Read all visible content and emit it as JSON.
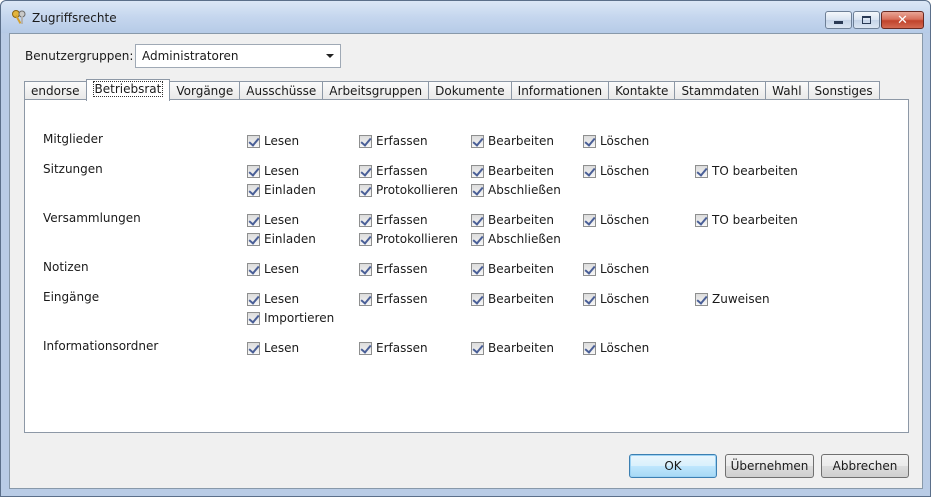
{
  "window": {
    "title": "Zugriffsrechte"
  },
  "groups": {
    "label": "Benutzergruppen:",
    "selected": "Administratoren"
  },
  "tabs": [
    "endorse",
    "Betriebsrat",
    "Vorgänge",
    "Ausschüsse",
    "Arbeitsgruppen",
    "Dokumente",
    "Informationen",
    "Kontakte",
    "Stammdaten",
    "Wahl",
    "Sonstiges"
  ],
  "active_tab": "Betriebsrat",
  "permissions": [
    {
      "label": "Mitglieder",
      "rows": [
        [
          "Lesen",
          "Erfassen",
          "Bearbeiten",
          "Löschen"
        ]
      ]
    },
    {
      "label": "Sitzungen",
      "rows": [
        [
          "Lesen",
          "Erfassen",
          "Bearbeiten",
          "Löschen",
          "TO bearbeiten"
        ],
        [
          "Einladen",
          "Protokollieren",
          "Abschließen"
        ]
      ]
    },
    {
      "label": "Versammlungen",
      "rows": [
        [
          "Lesen",
          "Erfassen",
          "Bearbeiten",
          "Löschen",
          "TO bearbeiten"
        ],
        [
          "Einladen",
          "Protokollieren",
          "Abschließen"
        ]
      ]
    },
    {
      "label": "Notizen",
      "rows": [
        [
          "Lesen",
          "Erfassen",
          "Bearbeiten",
          "Löschen"
        ]
      ]
    },
    {
      "label": "Eingänge",
      "rows": [
        [
          "Lesen",
          "Erfassen",
          "Bearbeiten",
          "Löschen",
          "Zuweisen"
        ],
        [
          "Importieren"
        ]
      ]
    },
    {
      "label": "Informationsordner",
      "rows": [
        [
          "Lesen",
          "Erfassen",
          "Bearbeiten",
          "Löschen"
        ]
      ]
    }
  ],
  "buttons": {
    "ok": "OK",
    "apply": "Übernehmen",
    "cancel": "Abbrechen"
  }
}
